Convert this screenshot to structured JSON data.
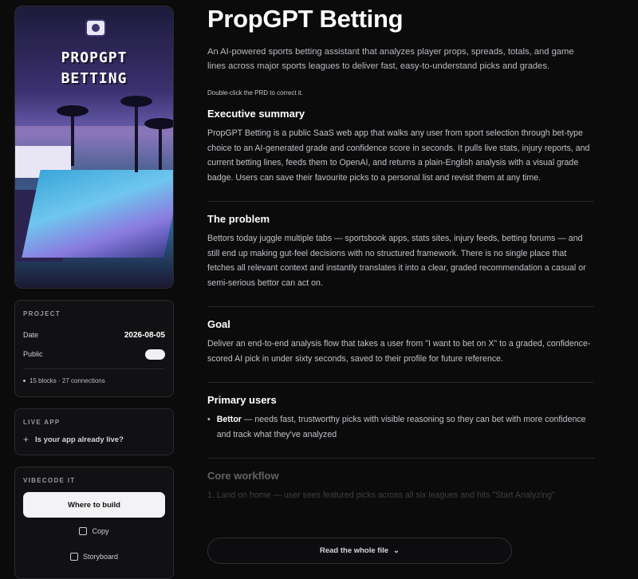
{
  "sidebar": {
    "cover_title_line1": "PROPGPT",
    "cover_title_line2": "BETTING",
    "project": {
      "label": "PROJECT",
      "date_label": "Date",
      "date_value": "2026-08-05",
      "public_label": "Public",
      "public_on": true,
      "meta": "15 blocks · 27 connections"
    },
    "live_app": {
      "label": "LIVE APP",
      "prompt": "Is your app already live?"
    },
    "vibecode": {
      "label": "VIBECODE IT",
      "where_to_build": "Where to build",
      "copy": "Copy",
      "storyboard": "Storyboard"
    }
  },
  "main": {
    "title": "PropGPT Betting",
    "intro": "An AI-powered sports betting assistant that analyzes player props, spreads, totals, and game lines across major sports leagues to deliver fast, easy-to-understand picks and grades.",
    "hint": "Double-click the PRD to correct it.",
    "sections": [
      {
        "heading": "Executive summary",
        "body": "PropGPT Betting is a public SaaS web app that walks any user from sport selection through bet-type choice to an AI-generated grade and confidence score in seconds. It pulls live stats, injury reports, and current betting lines, feeds them to OpenAI, and returns a plain-English analysis with a visual grade badge. Users can save their favourite picks to a personal list and revisit them at any time."
      },
      {
        "heading": "The problem",
        "body": "Bettors today juggle multiple tabs — sportsbook apps, stats sites, injury feeds, betting forums — and still end up making gut-feel decisions with no structured framework. There is no single place that fetches all relevant context and instantly translates it into a clear, graded recommendation a casual or semi-serious bettor can act on."
      },
      {
        "heading": "Goal",
        "body": "Deliver an end-to-end analysis flow that takes a user from \"I want to bet on X\" to a graded, confidence-scored AI pick in under sixty seconds, saved to their profile for future reference."
      },
      {
        "heading": "Primary users",
        "bullet_strong": "Bettor",
        "bullet_rest": " — needs fast, trustworthy picks with visible reasoning so they can bet with more confidence and track what they've analyzed"
      },
      {
        "heading": "Core workflow",
        "step": "1. Land on home — user sees featured picks across all six leagues and hits \"Start Analyzing\""
      }
    ],
    "read_whole_file": "Read the whole file"
  }
}
